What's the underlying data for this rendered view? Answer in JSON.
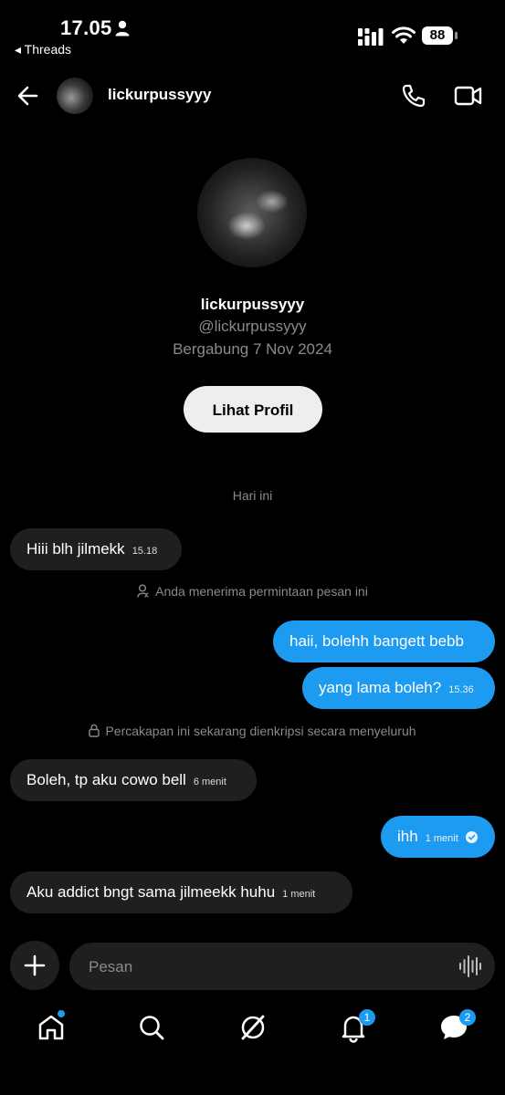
{
  "status_bar": {
    "time": "17.05",
    "back_app": "◂ Threads",
    "battery": "88"
  },
  "header": {
    "username": "lickurpussyyy"
  },
  "profile": {
    "name": "lickurpussyyy",
    "handle": "@lickurpussyyy",
    "joined": "Bergabung 7 Nov 2024",
    "button_label": "Lihat Profil"
  },
  "day_separator": "Hari ini",
  "messages": [
    {
      "dir": "in",
      "text": "Hiii blh jilmekk",
      "time": "15.18"
    },
    {
      "dir": "system",
      "text": "Anda menerima permintaan pesan ini"
    },
    {
      "dir": "out",
      "text": "haii, bolehh bangett bebb",
      "time": ""
    },
    {
      "dir": "out",
      "text": "yang lama boleh?",
      "time": "15.36"
    },
    {
      "dir": "system",
      "text": "Percakapan ini sekarang dienkripsi secara menyeluruh"
    },
    {
      "dir": "in",
      "text": "Boleh, tp aku cowo bell",
      "time": "6 menit"
    },
    {
      "dir": "out",
      "text": "ihh",
      "time": "1 menit",
      "read": true
    },
    {
      "dir": "in",
      "text": "Aku addict bngt sama jilmeekk huhu",
      "time": "1 menit"
    }
  ],
  "composer": {
    "placeholder": "Pesan"
  },
  "tabbar": {
    "notifications_badge": "1",
    "messages_badge": "2",
    "icons": [
      "home-icon",
      "search-icon",
      "explore-icon",
      "bell-icon",
      "chat-icon"
    ]
  }
}
